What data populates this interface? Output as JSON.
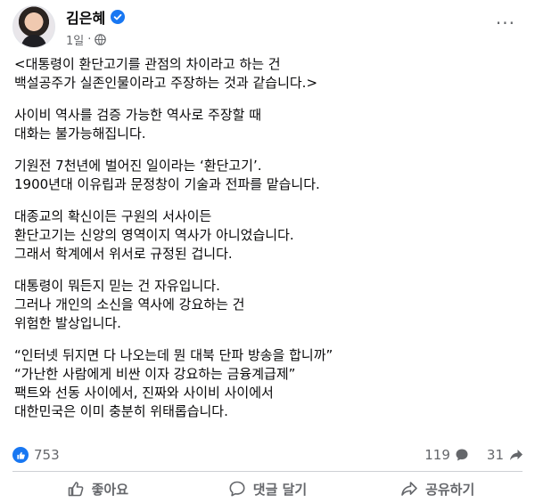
{
  "post": {
    "author": "김은혜",
    "time": "1일",
    "more_label": "···",
    "paragraphs": [
      [
        "<대통령이 환단고기를 관점의 차이라고 하는 건",
        "백설공주가 실존인물이라고 주장하는 것과 같습니다.>"
      ],
      [
        "사이비 역사를 검증 가능한 역사로 주장할 때",
        "대화는 불가능해집니다."
      ],
      [
        "기원전 7천년에 벌어진 일이라는 ‘환단고기’.",
        "1900년대 이유립과 문정창이 기술과 전파를 맡습니다."
      ],
      [
        "대종교의 확신이든 구원의 서사이든",
        "환단고기는 신앙의 영역이지 역사가 아니었습니다.",
        "그래서 학계에서 위서로 규정된 겁니다."
      ],
      [
        "대통령이 뭐든지 믿는 건 자유입니다.",
        "그러나 개인의 소신을 역사에 강요하는 건",
        "위험한 발상입니다."
      ],
      [
        "“인터넷 뒤지면 다 나오는데 뭔 대북 단파 방송을 합니까”",
        "“가난한 사람에게 비싼 이자 강요하는 금융계급제”",
        "팩트와 선동 사이에서, 진짜와 사이비 사이에서",
        "대한민국은 이미 충분히 위태롭습니다."
      ]
    ]
  },
  "stats": {
    "reactions": "753",
    "comments": "119",
    "shares": "31"
  },
  "actions": {
    "like": "좋아요",
    "comment": "댓글 달기",
    "share": "공유하기"
  },
  "colors": {
    "accent": "#1877f2",
    "secondary_text": "#65676b"
  },
  "icons": {
    "verified": "verified-badge-icon",
    "audience": "globe-icon",
    "reaction": "thumbs-up-icon",
    "comments": "comment-bubble-icon",
    "shares": "share-arrow-icon"
  }
}
